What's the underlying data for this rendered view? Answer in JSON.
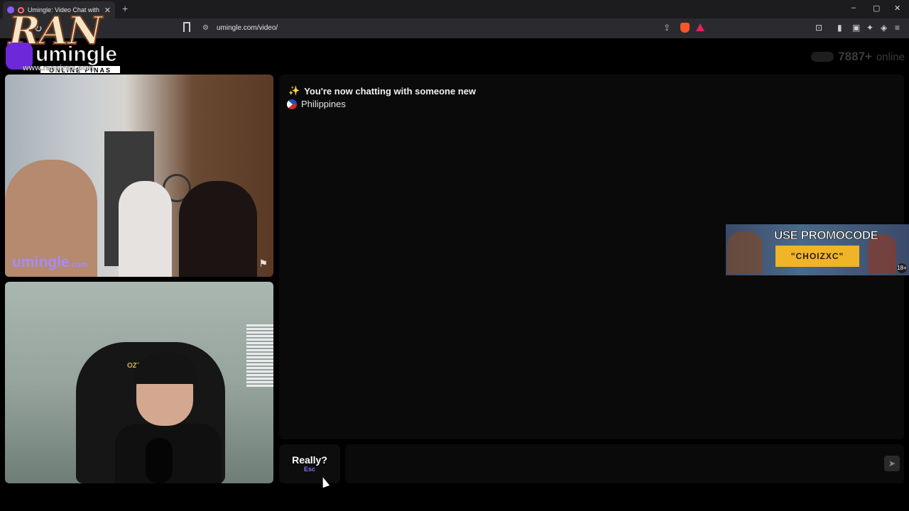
{
  "browser": {
    "tab_title": "Umingle: Video Chat with St",
    "tab_close": "✕",
    "new_tab": "+",
    "url": "umingle.com/video/",
    "window_controls": {
      "minimize": "–",
      "maximize": "▢",
      "close": "✕"
    }
  },
  "logo": {
    "overlay_text": "RAN",
    "brand": "umingle",
    "tagline": "ONLINE PINAS",
    "site": "www.ranpinas.com"
  },
  "online": {
    "count": "7887+",
    "label": "online"
  },
  "video_top": {
    "watermark": "umingle",
    "watermark_suffix": ".com"
  },
  "video_bottom": {
    "chair_text": "OZZ"
  },
  "chat": {
    "status": "You're now chatting with someone new",
    "country": "Philippines"
  },
  "ad": {
    "title": "USE PROMOCODE",
    "code": "\"CHOIZXC\"",
    "age": "18+"
  },
  "controls": {
    "skip_label": "Really?",
    "skip_key": "Esc",
    "send_icon": "send-icon"
  }
}
